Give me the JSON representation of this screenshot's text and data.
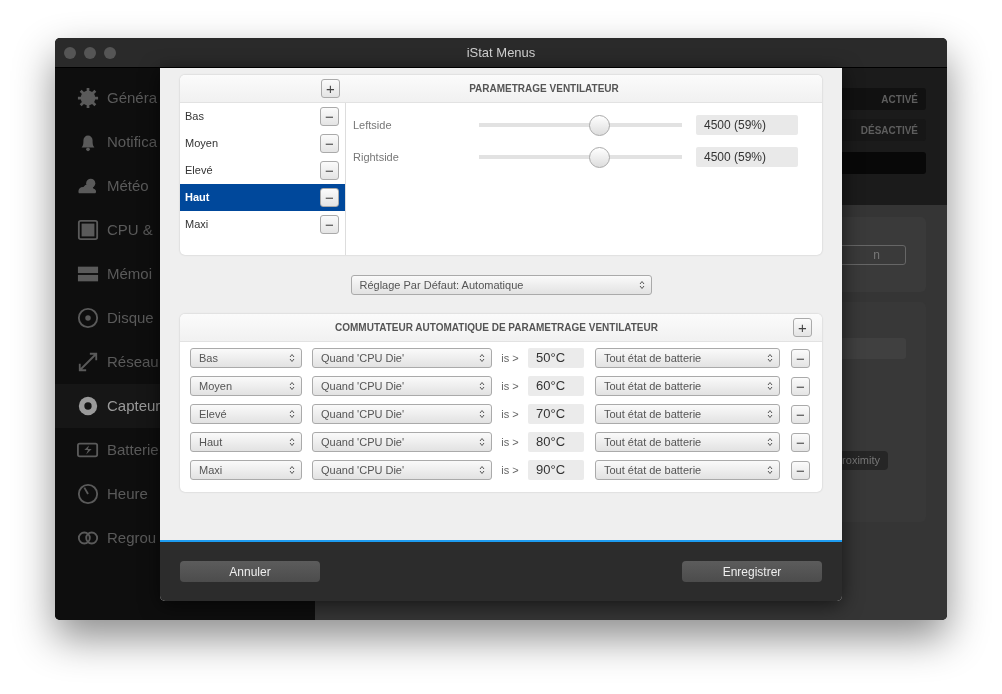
{
  "window": {
    "title": "iStat Menus"
  },
  "sidebar": {
    "items": [
      {
        "label": "Généra",
        "selected": false
      },
      {
        "label": "Notifica",
        "selected": false
      },
      {
        "label": "Météo",
        "selected": false
      },
      {
        "label": "CPU &",
        "selected": false
      },
      {
        "label": "Mémoi",
        "selected": false
      },
      {
        "label": "Disque",
        "selected": false
      },
      {
        "label": "Réseau",
        "selected": false
      },
      {
        "label": "Capteur",
        "selected": true
      },
      {
        "label": "Batterie",
        "selected": false
      },
      {
        "label": "Heure",
        "selected": false
      },
      {
        "label": "Regrou",
        "selected": false
      }
    ]
  },
  "background_panel": {
    "toggle_buttons": [
      {
        "label": "ACTIVÉ"
      },
      {
        "label": "DÉSACTIVÉ"
      }
    ],
    "field_value": "n",
    "proximity_button": "roximity"
  },
  "dialog": {
    "profiles": [
      {
        "label": "Bas",
        "selected": false
      },
      {
        "label": "Moyen",
        "selected": false
      },
      {
        "label": "Elevé",
        "selected": false
      },
      {
        "label": "Haut",
        "selected": true
      },
      {
        "label": "Maxi",
        "selected": false
      }
    ],
    "add_symbol": "+",
    "remove_symbol": "−",
    "settings_title": "PARAMETRAGE VENTILATEUR",
    "fans": [
      {
        "label": "Leftside",
        "level": 0.59,
        "reading": "4500 (59%)"
      },
      {
        "label": "Rightside",
        "level": 0.59,
        "reading": "4500 (59%)"
      }
    ],
    "default_select": "Réglage Par Défaut: Automatique",
    "rules_title": "COMMUTATEUR AUTOMATIQUE DE PARAMETRAGE VENTILATEUR",
    "rules": [
      {
        "profile": "Bas",
        "condition": "Quand 'CPU Die'",
        "operator": "is >",
        "temperature": "50°C",
        "battery": "Tout état de batterie"
      },
      {
        "profile": "Moyen",
        "condition": "Quand 'CPU Die'",
        "operator": "is >",
        "temperature": "60°C",
        "battery": "Tout état de batterie"
      },
      {
        "profile": "Elevé",
        "condition": "Quand 'CPU Die'",
        "operator": "is >",
        "temperature": "70°C",
        "battery": "Tout état de batterie"
      },
      {
        "profile": "Haut",
        "condition": "Quand 'CPU Die'",
        "operator": "is >",
        "temperature": "80°C",
        "battery": "Tout état de batterie"
      },
      {
        "profile": "Maxi",
        "condition": "Quand 'CPU Die'",
        "operator": "is >",
        "temperature": "90°C",
        "battery": "Tout état de batterie"
      }
    ],
    "buttons": [
      {
        "label": "Annuler"
      },
      {
        "label": "Enregistrer"
      }
    ]
  }
}
